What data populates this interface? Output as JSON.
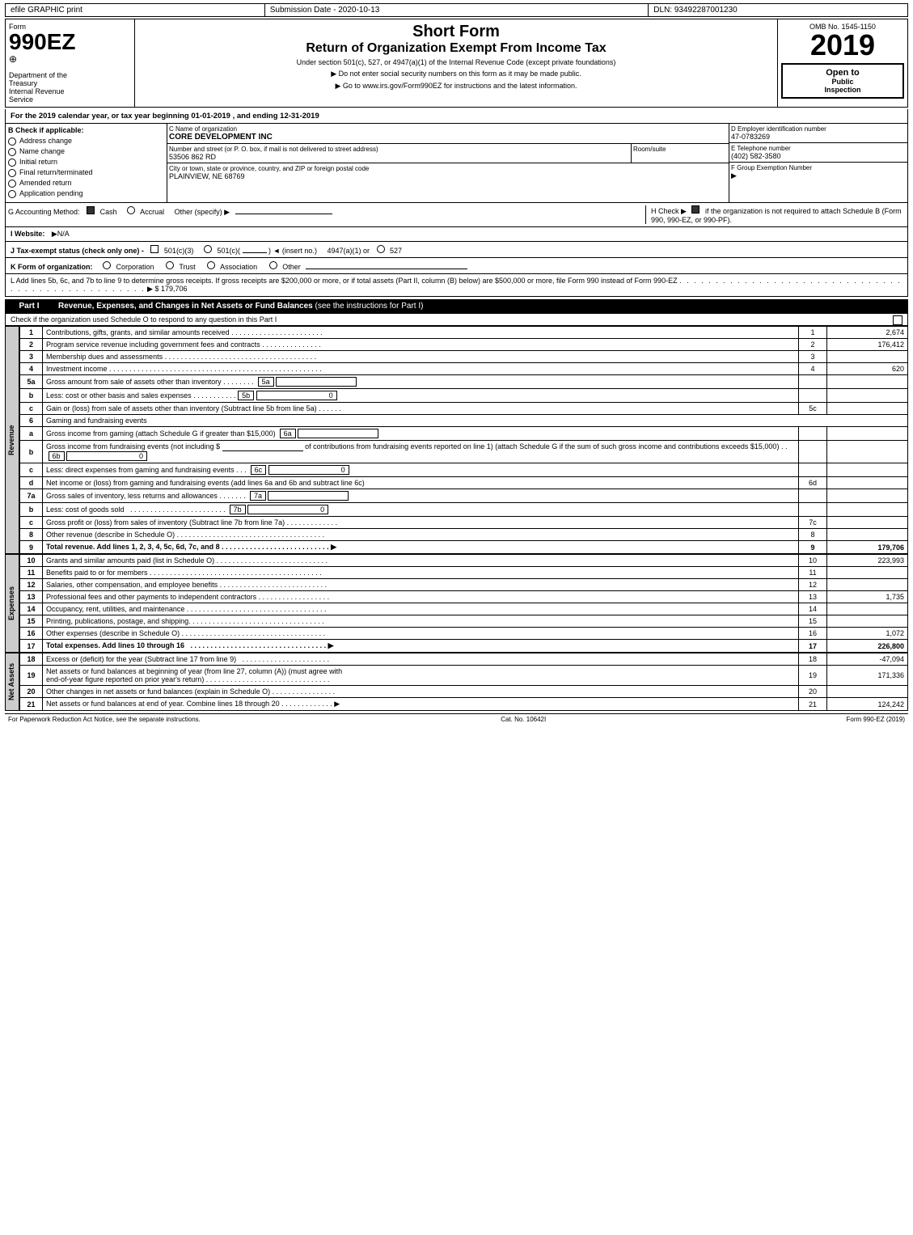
{
  "topbar": {
    "left": "efile GRAPHIC print",
    "mid": "Submission Date - 2020-10-13",
    "right": "DLN: 93492287001230"
  },
  "form": {
    "number": "990EZ",
    "sub": "⊕",
    "dept1": "Department of the",
    "dept2": "Treasury",
    "dept3": "Internal Revenue",
    "dept4": "Service"
  },
  "title": {
    "short": "Short Form",
    "main": "Return of Organization Exempt From Income Tax",
    "sub1": "Under section 501(c), 527, or 4947(a)(1) of the Internal Revenue Code (except private foundations)",
    "notice1": "▶ Do not enter social security numbers on this form as it may be made public.",
    "notice2": "▶ Go to www.irs.gov/Form990EZ for instructions and the latest information."
  },
  "year_badge": "2019",
  "omb": "OMB No. 1545-1150",
  "open_label": "Open to Public Inspection",
  "tax_year_line": "For the 2019 calendar year, or tax year beginning 01-01-2019 , and ending 12-31-2019",
  "check_applicable": {
    "label": "B Check if applicable:",
    "items": [
      {
        "id": "address",
        "label": "Address change",
        "checked": false
      },
      {
        "id": "name",
        "label": "Name change",
        "checked": false
      },
      {
        "id": "initial",
        "label": "Initial return",
        "checked": false
      },
      {
        "id": "final",
        "label": "Final return/terminated",
        "checked": false
      },
      {
        "id": "amended",
        "label": "Amended return",
        "checked": false
      },
      {
        "id": "app_pending",
        "label": "Application pending",
        "checked": false
      }
    ]
  },
  "org": {
    "name_label": "C Name of organization",
    "name": "CORE DEVELOPMENT INC",
    "address_label": "Number and street (or P. O. box, if mail is not delivered to street address)",
    "address": "53506 862 RD",
    "room_label": "Room/suite",
    "room": "",
    "city_label": "City or town, state or province, country, and ZIP or foreign postal code",
    "city": "PLAINVIEW, NE  68769",
    "ein_label": "D Employer identification number",
    "ein": "47-0783269",
    "phone_label": "E Telephone number",
    "phone": "(402) 582-3580",
    "group_label": "F Group Exemption Number",
    "group": "▶"
  },
  "accounting": {
    "label": "G Accounting Method:",
    "cash_label": "Cash",
    "cash_checked": true,
    "accrual_label": "Accrual",
    "accrual_checked": false,
    "other_label": "Other (specify) ▶",
    "other_value": ""
  },
  "h_check": {
    "label": "H Check ▶",
    "checked": true,
    "text": "if the organization is not required to attach Schedule B (Form 990, 990-EZ, or 990-PF)."
  },
  "website": {
    "label": "I Website:",
    "value": "▶N/A"
  },
  "tax_status": {
    "label": "J Tax-exempt status (check only one) -",
    "status_501c3": "501(c)(3)",
    "status_501c3_checked": true,
    "status_501c": "501(c)(",
    "status_501c_checked": false,
    "insert_no": ") ◄ (insert no.)",
    "status_4947": "4947(a)(1) or",
    "status_527": "527",
    "status_527_checked": false
  },
  "k_section": {
    "label": "K Form of organization:",
    "corporation": "Corporation",
    "trust": "Trust",
    "association": "Association",
    "other": "Other"
  },
  "l_section": {
    "text": "L Add lines 5b, 6c, and 7b to line 9 to determine gross receipts. If gross receipts are $200,000 or more, or if total assets (Part II, column (B) below) are $500,000 or more, file Form 990 instead of Form 990-EZ",
    "dots": ". . . . . . . . . . . . . . . . . . . . . . . . . . . . . . . . . . . . . . . . . . . . . . . . . . .",
    "arrow": "▶ $",
    "value": "179,706"
  },
  "part1": {
    "label": "Part I",
    "title": "Revenue, Expenses, and Changes in Net Assets or Fund Balances",
    "inst": "(see the instructions for Part I)",
    "check_line": "Check if the organization used Schedule O to respond to any question in this Part I",
    "rows": [
      {
        "num": "1",
        "label": "Contributions, gifts, grants, and similar amounts received",
        "dots": true,
        "line_ref": "1",
        "value": "2,674"
      },
      {
        "num": "2",
        "label": "Program service revenue including government fees and contracts",
        "dots": true,
        "line_ref": "2",
        "value": "176,412"
      },
      {
        "num": "3",
        "label": "Membership dues and assessments",
        "dots": true,
        "line_ref": "3",
        "value": ""
      },
      {
        "num": "4",
        "label": "Investment income",
        "dots": true,
        "line_ref": "4",
        "value": "620"
      },
      {
        "num": "5a",
        "label": "Gross amount from sale of assets other than inventory",
        "dots": false,
        "sub_line": "5a",
        "sub_value": "",
        "line_ref": "",
        "value": ""
      },
      {
        "num": "5b",
        "label": "Less: cost or other basis and sales expenses",
        "dots": false,
        "sub_line": "5b",
        "sub_value": "0",
        "line_ref": "",
        "value": ""
      },
      {
        "num": "5c",
        "label": "Gain or (loss) from sale of assets other than inventory (Subtract line 5b from line 5a)",
        "dots": false,
        "line_ref": "5c",
        "value": ""
      },
      {
        "num": "6",
        "label": "Gaming and fundraising events",
        "dots": false,
        "line_ref": "",
        "value": ""
      },
      {
        "num": "6a",
        "label": "Gross income from gaming (attach Schedule G if greater than $15,000)",
        "sub_line": "6a",
        "sub_value": "",
        "line_ref": "",
        "value": ""
      },
      {
        "num": "6b",
        "label_part1": "Gross income from fundraising events (not including $",
        "blank": "_______________",
        "label_part2": " of contributions from fundraising events reported on line 1) (attach Schedule G if the sum of such gross income and contributions exceeds $15,000)",
        "sub_line": "6b",
        "sub_value": "0",
        "line_ref": "",
        "value": ""
      },
      {
        "num": "6c",
        "label": "Less: direct expenses from gaming and fundraising events",
        "dots": false,
        "sub_line": "6c",
        "sub_value": "0",
        "line_ref": "",
        "value": ""
      },
      {
        "num": "6d",
        "label": "Net income or (loss) from gaming and fundraising events (add lines 6a and 6b and subtract line 6c)",
        "dots": false,
        "line_ref": "6d",
        "value": ""
      },
      {
        "num": "7a",
        "label": "Gross sales of inventory, less returns and allowances",
        "dots": false,
        "sub_line": "7a",
        "sub_value": "",
        "line_ref": "",
        "value": ""
      },
      {
        "num": "7b",
        "label": "Less: cost of goods sold",
        "dots": false,
        "sub_line": "7b",
        "sub_value": "0",
        "line_ref": "",
        "value": ""
      },
      {
        "num": "7c",
        "label": "Gross profit or (loss) from sales of inventory (Subtract line 7b from line 7a)",
        "dots": false,
        "line_ref": "7c",
        "value": ""
      },
      {
        "num": "8",
        "label": "Other revenue (describe in Schedule O)",
        "dots": false,
        "line_ref": "8",
        "value": ""
      },
      {
        "num": "9",
        "label": "Total revenue. Add lines 1, 2, 3, 4, 5c, 6d, 7c, and 8",
        "dots": true,
        "arrow": "▶",
        "line_ref": "9",
        "value": "179,706",
        "bold": true
      }
    ]
  },
  "expenses": {
    "rows": [
      {
        "num": "10",
        "label": "Grants and similar amounts paid (list in Schedule O)",
        "dots": true,
        "line_ref": "10",
        "value": "223,993"
      },
      {
        "num": "11",
        "label": "Benefits paid to or for members",
        "dots": true,
        "line_ref": "11",
        "value": ""
      },
      {
        "num": "12",
        "label": "Salaries, other compensation, and employee benefits",
        "dots": true,
        "line_ref": "12",
        "value": ""
      },
      {
        "num": "13",
        "label": "Professional fees and other payments to independent contractors",
        "dots": true,
        "line_ref": "13",
        "value": "1,735"
      },
      {
        "num": "14",
        "label": "Occupancy, rent, utilities, and maintenance",
        "dots": true,
        "line_ref": "14",
        "value": ""
      },
      {
        "num": "15",
        "label": "Printing, publications, postage, and shipping",
        "dots": true,
        "line_ref": "15",
        "value": ""
      },
      {
        "num": "16",
        "label": "Other expenses (describe in Schedule O)",
        "dots": true,
        "line_ref": "16",
        "value": "1,072"
      },
      {
        "num": "17",
        "label": "Total expenses. Add lines 10 through 16",
        "dots": true,
        "arrow": "▶",
        "line_ref": "17",
        "value": "226,800",
        "bold": true
      }
    ]
  },
  "net_assets": {
    "rows": [
      {
        "num": "18",
        "label": "Excess or (deficit) for the year (Subtract line 17 from line 9)",
        "dots": true,
        "line_ref": "18",
        "value": "-47,094"
      },
      {
        "num": "19",
        "label": "Net assets or fund balances at beginning of year (from line 27, column (A)) (must agree with end-of-year figure reported on prior year's return)",
        "dots": true,
        "line_ref": "19",
        "value": "171,336"
      },
      {
        "num": "20",
        "label": "Other changes in net assets or fund balances (explain in Schedule O)",
        "dots": true,
        "line_ref": "20",
        "value": ""
      },
      {
        "num": "21",
        "label": "Net assets or fund balances at end of year. Combine lines 18 through 20",
        "dots": true,
        "arrow": "▶",
        "line_ref": "21",
        "value": "124,242"
      }
    ]
  },
  "footer": {
    "left": "For Paperwork Reduction Act Notice, see the separate instructions.",
    "cat": "Cat. No. 10642I",
    "right": "Form 990-EZ (2019)"
  }
}
